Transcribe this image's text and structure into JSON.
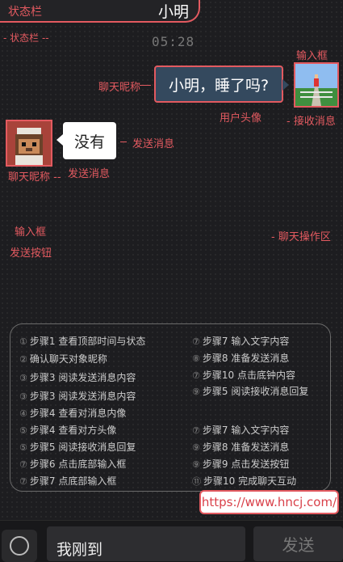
{
  "header": {
    "status_label": "状态栏",
    "contact_name": "小明",
    "status_label_2": "- 状态栏 --",
    "time": "05:28"
  },
  "annotations": {
    "input_box_top": "输入框",
    "nickname_right": "聊天昵称",
    "user_avatar": "用户头像",
    "receive_msg": "- 接收消息",
    "send_msg_right": "发送消息",
    "nickname_left": "聊天昵称 --",
    "send_msg_left": "发送消息",
    "input_box_mid": "输入框",
    "send_button_mid": "发送按钮",
    "chat_ops": "- 聊天操作区"
  },
  "messages": {
    "incoming": "小明，睡了吗?",
    "outgoing": "没有"
  },
  "steps": [
    {
      "num": "①",
      "text": "步骤1 查看顶部时间与状态"
    },
    {
      "num": "②",
      "text": "确认聊天对象昵称"
    },
    {
      "num": "③",
      "text": "步骤3 阅读发送消息内容"
    },
    {
      "num": "③",
      "text": "步骤3 阅读发送消息内容"
    },
    {
      "num": "④",
      "text": "步骤4 查看对消息内像"
    },
    {
      "num": "⑤",
      "text": "步骤4 查看对方头像"
    },
    {
      "num": "⑤",
      "text": "步骤5 阅读接收消息回复"
    },
    {
      "num": "⑦",
      "text": "步骤6 点击底部输入框"
    },
    {
      "num": "⑦",
      "text": "步骤7 点底部输入框"
    },
    {
      "num": "⑦",
      "text": "步骤7 输入文字内容"
    },
    {
      "num": "⑧",
      "text": "步骤8 准备发送消息"
    },
    {
      "num": "⑦",
      "text": "步骤10 点击底钟内容"
    },
    {
      "num": "⑨",
      "text": "步骤5 阅读接收消息回复"
    },
    {
      "num": "⑦",
      "text": "步骤7 输入文字内容"
    },
    {
      "num": "⑨",
      "text": "步骤8 准备发送消息"
    },
    {
      "num": "⑨",
      "text": "步骤9 点击发送按钮"
    },
    {
      "num": "⑪",
      "text": "步骤10 完成聊天互动"
    }
  ],
  "url": "https://www.hncj.com/",
  "input": {
    "value": "我刚到"
  },
  "send_button": {
    "label": "发送"
  },
  "icons": {
    "mic": "voice-icon"
  },
  "colors": {
    "accent": "#e35a60",
    "incoming_bubble": "#34495e",
    "outgoing_bubble": "#ffffff"
  }
}
